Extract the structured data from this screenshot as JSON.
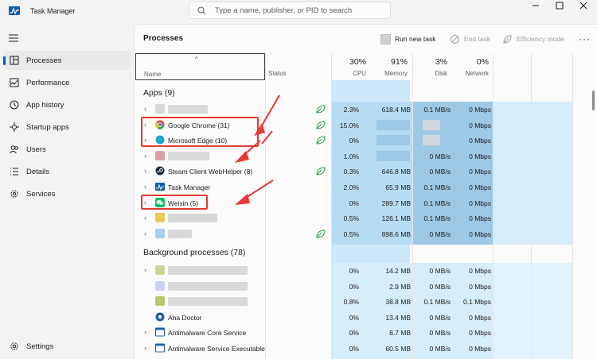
{
  "window": {
    "title": "Task Manager",
    "search_placeholder": "Type a name, publisher, or PID to search"
  },
  "sidebar": {
    "items": [
      {
        "label": "Processes",
        "icon": "processes-icon",
        "active": true
      },
      {
        "label": "Performance",
        "icon": "performance-icon"
      },
      {
        "label": "App history",
        "icon": "app-history-icon"
      },
      {
        "label": "Startup apps",
        "icon": "startup-apps-icon"
      },
      {
        "label": "Users",
        "icon": "users-icon"
      },
      {
        "label": "Details",
        "icon": "details-icon"
      },
      {
        "label": "Services",
        "icon": "services-icon"
      }
    ],
    "settings_label": "Settings"
  },
  "toolbar": {
    "page_title": "Processes",
    "run_new_task": "Run new task",
    "end_task": "End task",
    "efficiency_mode": "Efficiency mode"
  },
  "columns": {
    "name": "Name",
    "status": "Status",
    "cpu": {
      "value": "30%",
      "label": "CPU"
    },
    "memory": {
      "value": "91%",
      "label": "Memory"
    },
    "disk": {
      "value": "3%",
      "label": "Disk"
    },
    "network": {
      "value": "0%",
      "label": "Network"
    }
  },
  "sections": {
    "apps": "Apps (9)",
    "background": "Background processes (78)"
  },
  "apps": [
    {
      "name": "",
      "cpu": "2.3%",
      "memory": "618.4 MB",
      "disk": "0.1 MB/s",
      "network": "0 Mbps"
    },
    {
      "name": "Google Chrome (31)",
      "cpu": "15.0%",
      "memory": "",
      "disk": "",
      "network": "0 Mbps"
    },
    {
      "name": "Microsoft Edge (10)",
      "cpu": "0%",
      "memory": "",
      "disk": "",
      "network": "0 Mbps"
    },
    {
      "name": "",
      "cpu": "1.0%",
      "memory": "",
      "disk": "0 MB/s",
      "network": "0 Mbps"
    },
    {
      "name": "Steam Client WebHelper (8)",
      "cpu": "0.3%",
      "memory": "646.8 MB",
      "disk": "0 MB/s",
      "network": "0 Mbps"
    },
    {
      "name": "Task Manager",
      "cpu": "2.0%",
      "memory": "65.9 MB",
      "disk": "0.1 MB/s",
      "network": "0 Mbps"
    },
    {
      "name": "Weixin (5)",
      "cpu": "0%",
      "memory": "289.7 MB",
      "disk": "0.1 MB/s",
      "network": "0 Mbps"
    },
    {
      "name": "",
      "cpu": "0.5%",
      "memory": "126.1 MB",
      "disk": "0.1 MB/s",
      "network": "0 Mbps"
    },
    {
      "name": "",
      "cpu": "0.5%",
      "memory": "898.6 MB",
      "disk": "0 MB/s",
      "network": "0 Mbps"
    }
  ],
  "background": [
    {
      "name": "",
      "cpu": "0%",
      "memory": "14.2 MB",
      "disk": "0 MB/s",
      "network": "0 Mbps"
    },
    {
      "name": "",
      "cpu": "0%",
      "memory": "2.9 MB",
      "disk": "0 MB/s",
      "network": "0 Mbps"
    },
    {
      "name": "",
      "cpu": "0.8%",
      "memory": "38.8 MB",
      "disk": "0.1 MB/s",
      "network": "0.1 Mbps"
    },
    {
      "name": "Aha Doctor",
      "cpu": "0%",
      "memory": "13.4 MB",
      "disk": "0 MB/s",
      "network": "0 Mbps"
    },
    {
      "name": "Antimalware Core Service",
      "cpu": "0%",
      "memory": "8.7 MB",
      "disk": "0 MB/s",
      "network": "0 Mbps"
    },
    {
      "name": "Antimalware Service Executable",
      "cpu": "0%",
      "memory": "60.5 MB",
      "disk": "0 MB/s",
      "network": "0 Mbps"
    }
  ],
  "colors": {
    "accent": "#005fb8",
    "heat_light": "#fff4c4",
    "annotation_red": "#e53935"
  }
}
